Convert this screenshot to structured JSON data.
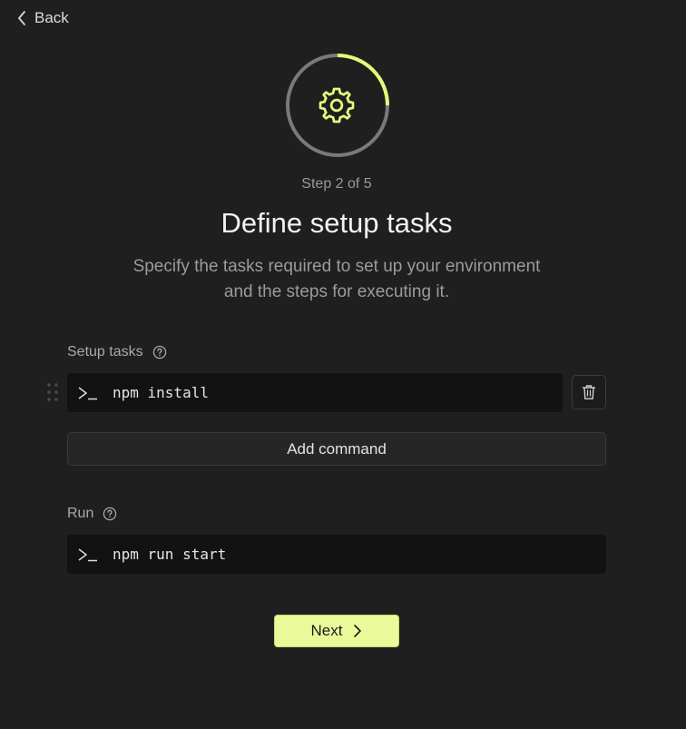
{
  "nav": {
    "back_label": "Back"
  },
  "progress": {
    "current": 2,
    "total": 5,
    "fraction": 0.25
  },
  "colors": {
    "accent": "#E6F87A",
    "background": "#1F1F1F",
    "field_background": "#121212",
    "ring_track": "#7A7A7A",
    "next_button": "#EAF99A"
  },
  "icons": {
    "back": "chevron-left-icon",
    "step": "gear-icon",
    "help": "question-circle-icon",
    "terminal": "terminal-prompt-icon",
    "drag": "drag-handle-icon",
    "delete": "trash-icon",
    "next": "chevron-right-icon"
  },
  "header": {
    "step_text": "Step 2 of 5",
    "title": "Define setup tasks",
    "subtitle": "Specify the tasks required to set up your environment and the steps for executing it."
  },
  "setup": {
    "label": "Setup tasks",
    "commands": [
      {
        "value": "npm install"
      }
    ],
    "add_label": "Add command"
  },
  "run": {
    "label": "Run",
    "command": "npm run start"
  },
  "footer": {
    "next_label": "Next"
  }
}
